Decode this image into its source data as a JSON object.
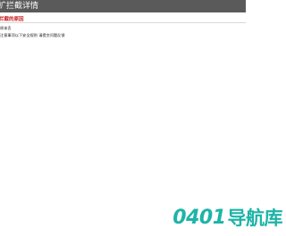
{
  "header": {
    "title": "扩拦截详情"
  },
  "reason": {
    "title": "拦截的原因"
  },
  "content": {
    "line1": "原本丢",
    "line2": "注意事项以下安全规则 请提交问题反馈"
  },
  "watermark": {
    "number": "0401",
    "text": "导航库"
  },
  "colors": {
    "header_bg": "#5a5a5a",
    "reason_red": "#c81e1e",
    "brand_teal": "#1eb4a8"
  }
}
